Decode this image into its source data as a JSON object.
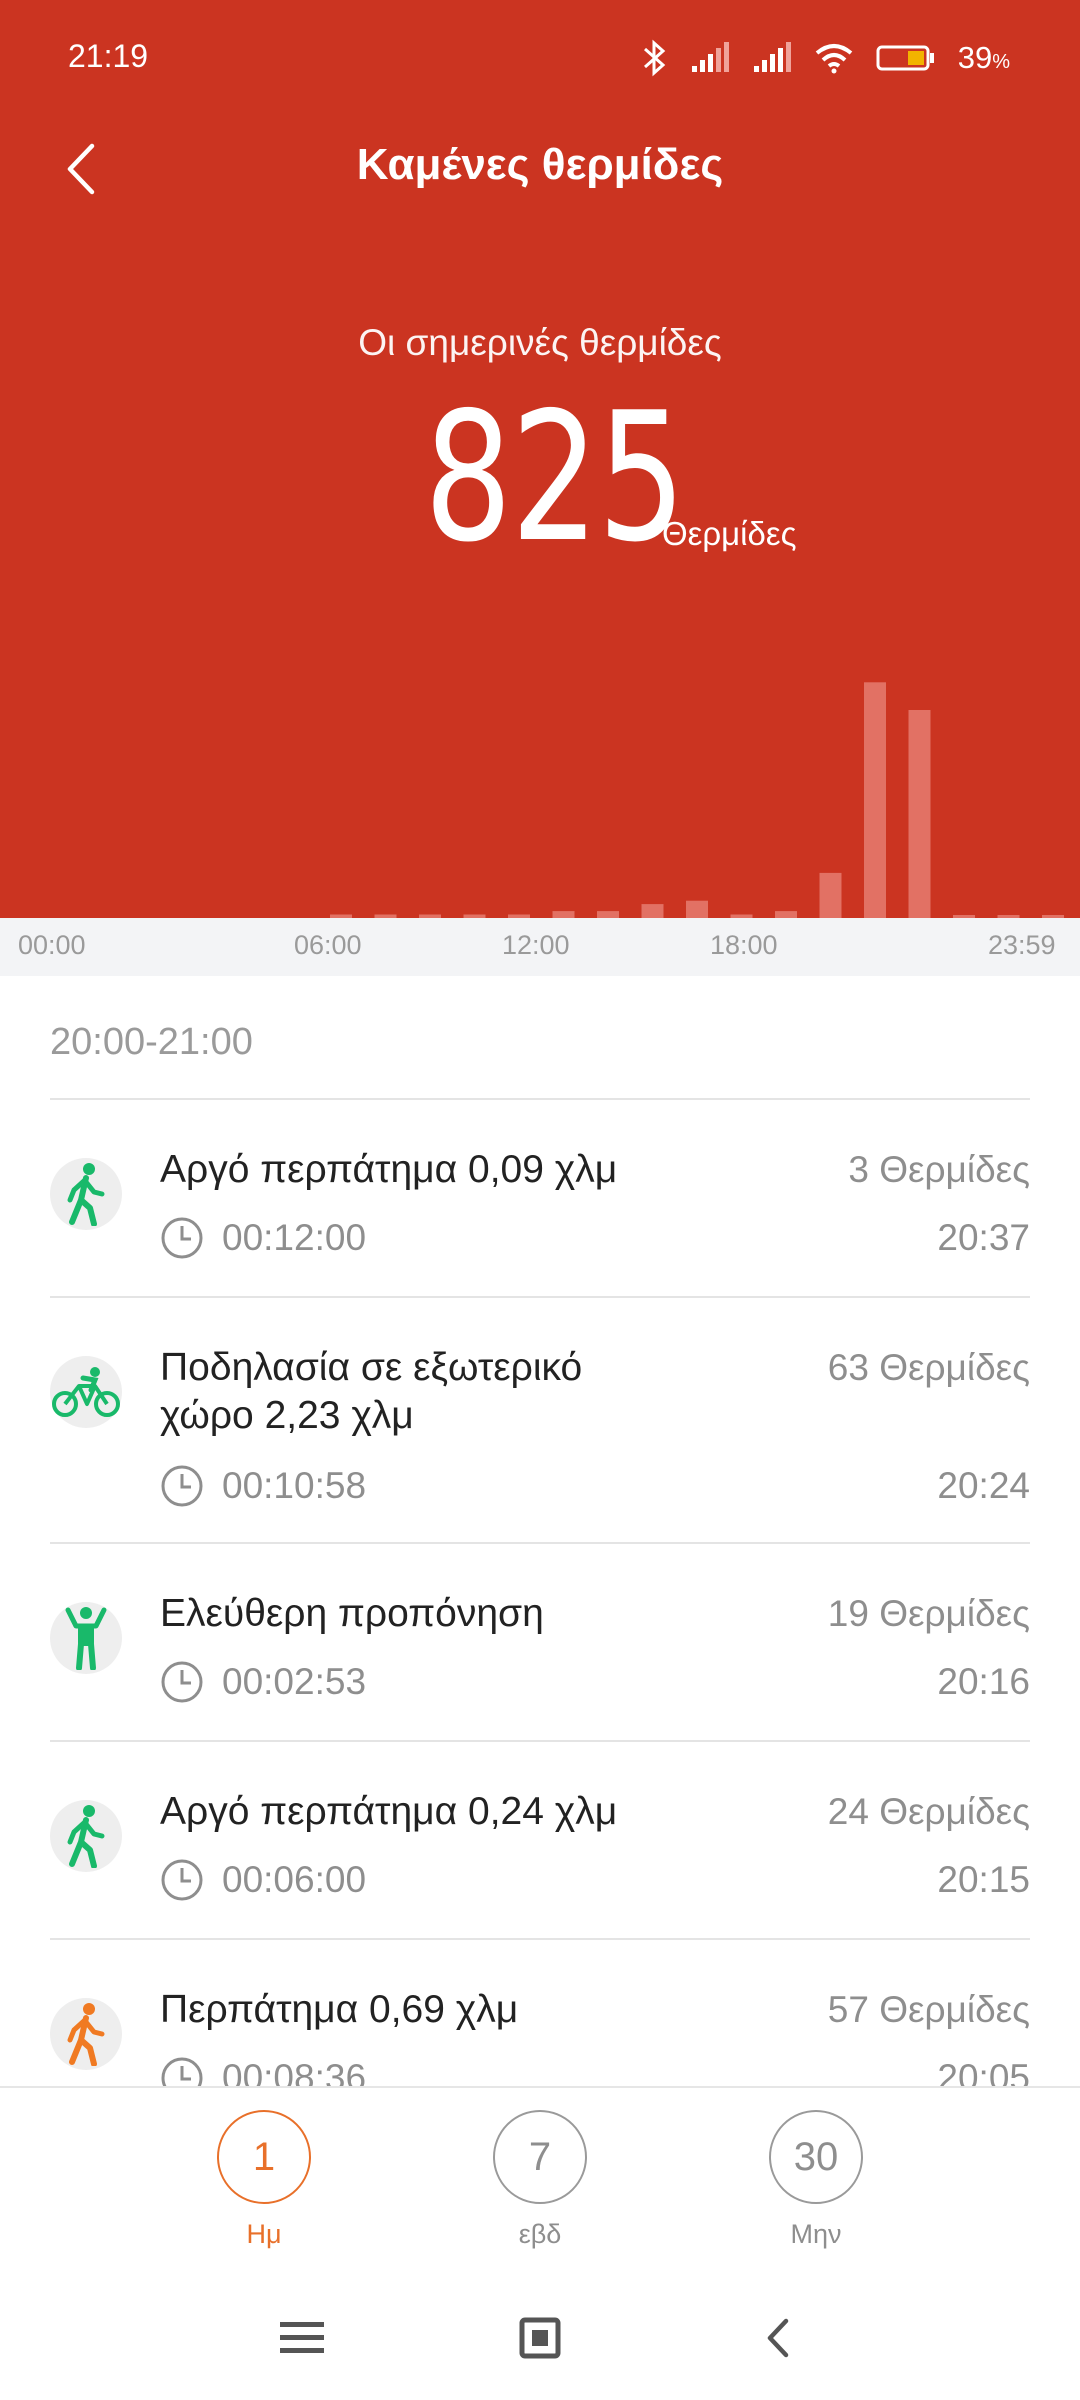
{
  "status_bar": {
    "time": "21:19",
    "battery": "39",
    "battery_unit": "%"
  },
  "header": {
    "title": "Καμένες θερμίδες",
    "today_label": "Οι σημερινές θερμίδες",
    "today_value": "825",
    "unit": "Θερμίδες",
    "colors": {
      "background": "#cb3421",
      "bars": "#e67d70"
    }
  },
  "chart_data": {
    "type": "bar",
    "x_labels": [
      "00:00",
      "06:00",
      "12:00",
      "18:00",
      "23:59"
    ],
    "categories": [
      "00:00",
      "01:00",
      "02:00",
      "03:00",
      "04:00",
      "05:00",
      "06:00",
      "07:00",
      "08:00",
      "09:00",
      "10:00",
      "11:00",
      "12:00",
      "13:00",
      "14:00",
      "15:00",
      "16:00",
      "17:00",
      "18:00",
      "19:00",
      "20:00",
      "21:00",
      "22:00",
      "23:00"
    ],
    "values": [
      0,
      0,
      0,
      0,
      0,
      0,
      1,
      1,
      1,
      1,
      1,
      2,
      2,
      4,
      5,
      1,
      2,
      13,
      68,
      60,
      0,
      0,
      0,
      0
    ],
    "ylim": [
      0,
      75
    ],
    "grid": false
  },
  "list": {
    "section_header": "20:00-21:00",
    "items": [
      {
        "icon": "walking-icon",
        "icon_color": "#19b96a",
        "title": "Αργό περπάτημα 0,09 χλμ",
        "duration": "00:12:00",
        "calories": "3 Θερμίδες",
        "time": "20:37"
      },
      {
        "icon": "cycling-icon",
        "icon_color": "#19b96a",
        "title": "Ποδηλασία σε εξωτερικό χώρο 2,23 χλμ",
        "duration": "00:10:58",
        "calories": "63 Θερμίδες",
        "time": "20:24"
      },
      {
        "icon": "free-training-icon",
        "icon_color": "#19b96a",
        "title": "Ελεύθερη προπόνηση",
        "duration": "00:02:53",
        "calories": "19 Θερμίδες",
        "time": "20:16"
      },
      {
        "icon": "walking-icon",
        "icon_color": "#19b96a",
        "title": "Αργό περπάτημα 0,24 χλμ",
        "duration": "00:06:00",
        "calories": "24 Θερμίδες",
        "time": "20:15"
      },
      {
        "icon": "walking-icon",
        "icon_color": "#f07a22",
        "title": "Περπάτημα 0,69 χλμ",
        "duration": "00:08:36",
        "calories": "57 Θερμίδες",
        "time": "20:05"
      }
    ]
  },
  "period_selector": {
    "items": [
      {
        "value": "1",
        "label": "Ημ",
        "active": true
      },
      {
        "value": "7",
        "label": "εβδ",
        "active": false
      },
      {
        "value": "30",
        "label": "Μην",
        "active": false
      }
    ],
    "accent": "#e8702a"
  },
  "system_nav": {
    "buttons": [
      "menu-icon",
      "home-icon",
      "back-icon"
    ]
  }
}
